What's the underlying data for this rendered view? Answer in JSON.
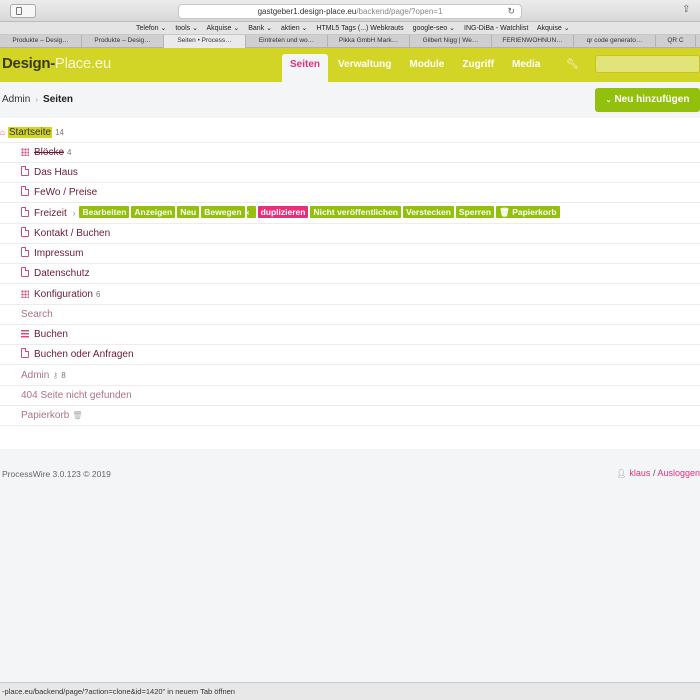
{
  "browser": {
    "url_host": "gastgeber1.design-place.eu",
    "url_path": "/backend/page/?open=1",
    "bookmarks": [
      "Telefon ⌄",
      "tools ⌄",
      "Akquise ⌄",
      "Bank ⌄",
      "aktien ⌄",
      "HTML5 Tags (...) Webkrauts",
      "google-seo ⌄",
      "ING-DiBa - Watchlist",
      "Akquise ⌄"
    ],
    "tabs": [
      "Produkte – Desig…",
      "Produkte – Desig…",
      "Seiten • Process…",
      "Eintreten und wo…",
      "Pikka GmbH Mark…",
      "Gilbert Nigg | We…",
      "FERIENWOHNUN…",
      "qr code generato…",
      "QR C"
    ],
    "active_tab": 2,
    "status_text": "-place.eu/backend/page/?action=clone&id=1420\" in neuem Tab öffnen"
  },
  "header": {
    "logo_dark": "Design-",
    "logo_light": "Place.eu",
    "nav": [
      "Seiten",
      "Verwaltung",
      "Module",
      "Zugriff",
      "Media"
    ],
    "active_nav": 0
  },
  "breadcrumb": {
    "root": "Admin",
    "sep": "›",
    "current": "Seiten"
  },
  "add_button": {
    "chevron": "⌄",
    "label": "Neu hinzufügen"
  },
  "tree": {
    "root": {
      "label": "Startseite",
      "count": "14"
    },
    "items": [
      {
        "label": "Blöcke",
        "count": "4"
      },
      {
        "label": "Das Haus"
      },
      {
        "label": "FeWo / Preise"
      },
      {
        "label": "Freizeit"
      },
      {
        "label": "Kontakt / Buchen"
      },
      {
        "label": "Impressum"
      },
      {
        "label": "Datenschutz"
      },
      {
        "label": "Konfiguration",
        "count": "6"
      },
      {
        "label": "Search"
      },
      {
        "label": "Buchen"
      },
      {
        "label": "Buchen oder Anfragen"
      },
      {
        "label": "Admin",
        "count": "8"
      },
      {
        "label": "404 Seite nicht gefunden"
      },
      {
        "label": "Papierkorb"
      }
    ],
    "actions": {
      "arrow": "›",
      "edit": "Bearbeiten",
      "view": "Anzeigen",
      "new": "Neu",
      "move": "Bewegen",
      "more": "‹",
      "copy": "duplizieren",
      "unpublish": "Nicht veröffentlichen",
      "hide": "Verstecken",
      "lock": "Sperren",
      "trash": "Papierkorb"
    }
  },
  "footer": {
    "version": "ProcessWire 3.0.123 © 2019",
    "user": "klaus",
    "logout": "Ausloggen"
  }
}
